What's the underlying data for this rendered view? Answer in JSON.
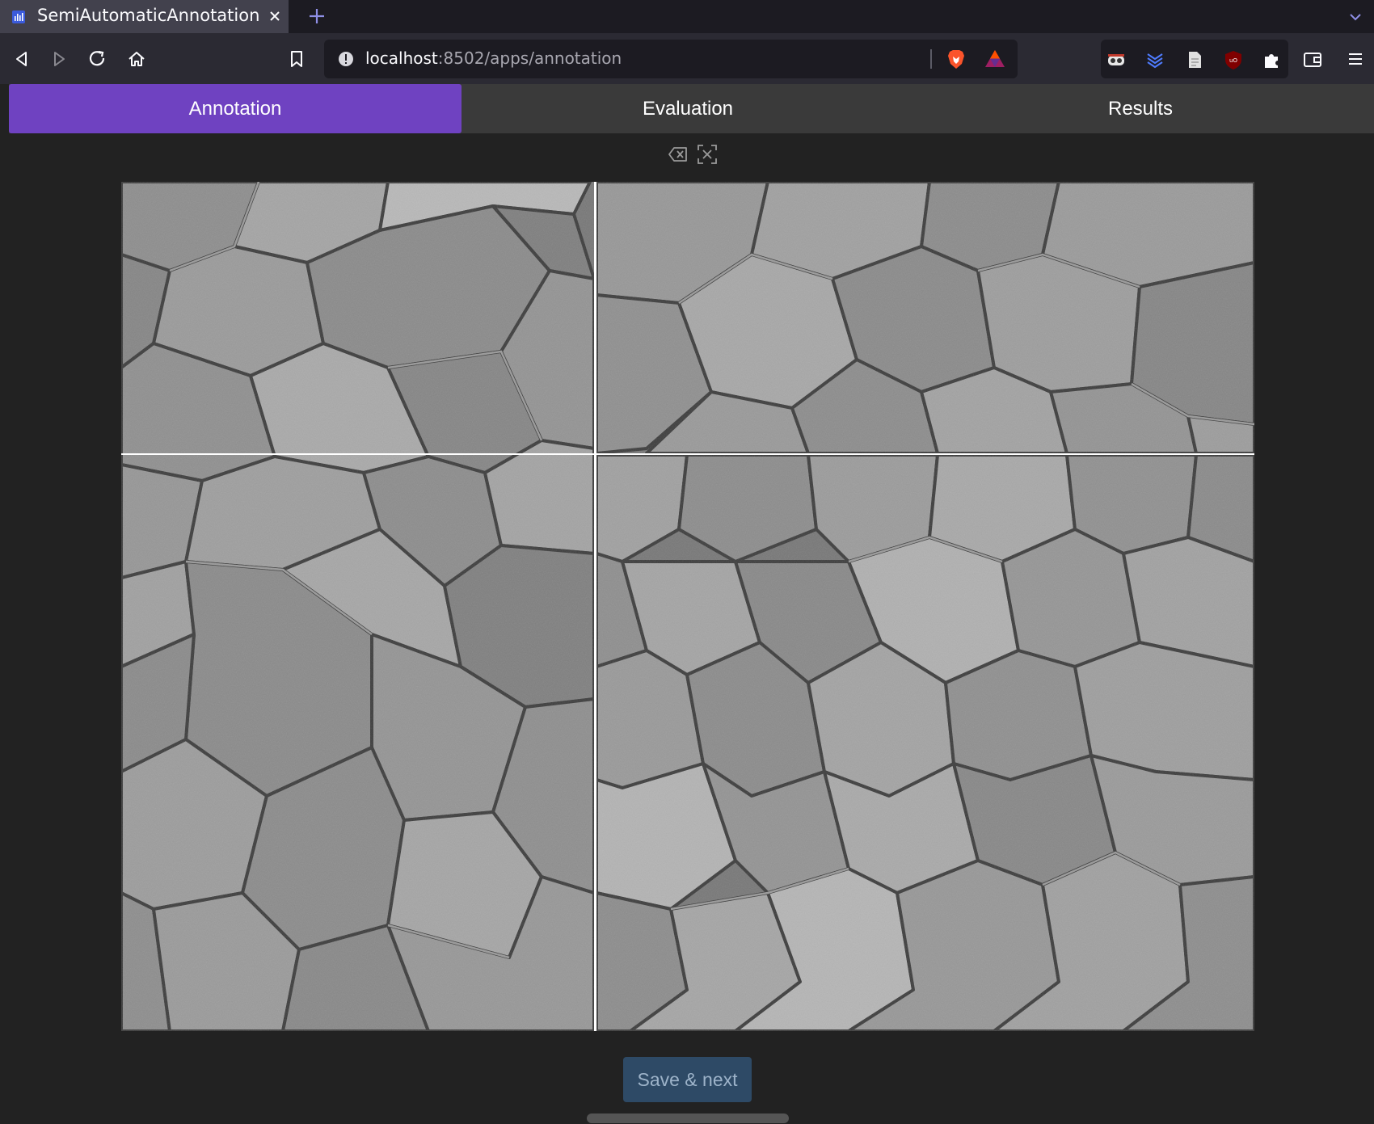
{
  "browser": {
    "tab_title": "SemiAutomaticAnnotation",
    "url_host": "localhost",
    "url_rest": ":8502/apps/annotation"
  },
  "app": {
    "tabs": [
      {
        "label": "Annotation",
        "active": true
      },
      {
        "label": "Evaluation",
        "active": false
      },
      {
        "label": "Results",
        "active": false
      }
    ],
    "accent_color": "#6f42c1",
    "save_label": "Save & next",
    "image_description_icon": "microscopy-grain-image"
  },
  "icons": {
    "tab": [
      "streamlit-favicon-icon",
      "close-icon",
      "plus-icon",
      "chevron-down-icon"
    ],
    "nav": [
      "back-icon",
      "forward-icon",
      "reload-icon",
      "home-icon",
      "bookmark-icon",
      "info-icon",
      "brave-shield-icon",
      "bat-rewards-icon"
    ],
    "extensions": [
      "privacy-badger-icon",
      "layers-icon",
      "document-icon",
      "ublock-icon",
      "puzzle-icon",
      "wallet-icon",
      "menu-icon"
    ],
    "canvas_tools": [
      "erase-icon",
      "fit-screen-icon"
    ]
  }
}
